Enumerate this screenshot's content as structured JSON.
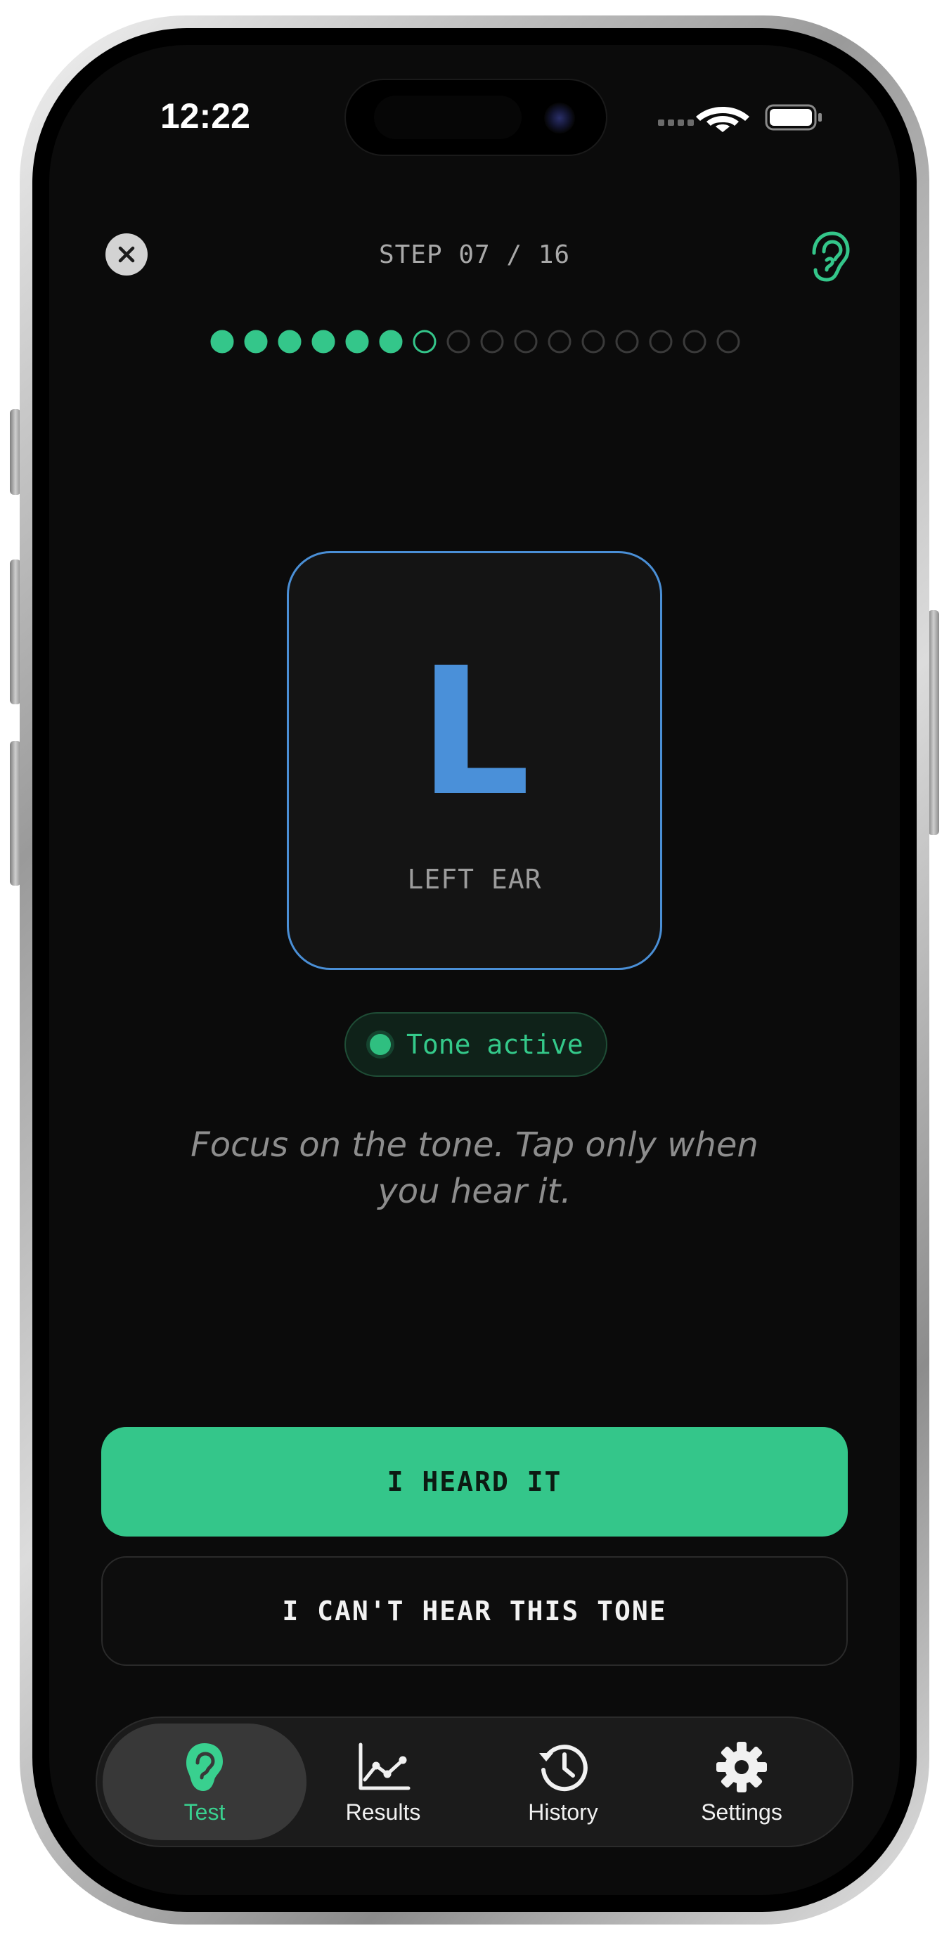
{
  "status_bar": {
    "time": "12:22"
  },
  "header": {
    "step_label": "STEP 07 / 16",
    "progress": {
      "current": 7,
      "total": 16,
      "completed": 6
    }
  },
  "ear_card": {
    "letter": "L",
    "caption": "LEFT EAR"
  },
  "tone_status": {
    "label": "Tone active"
  },
  "instruction": "Focus on the tone. Tap only when you hear it.",
  "actions": {
    "heard_label": "I HEARD IT",
    "cant_hear_label": "I CAN'T HEAR THIS TONE"
  },
  "tabs": [
    {
      "label": "Test",
      "icon": "ear-icon",
      "active": true
    },
    {
      "label": "Results",
      "icon": "chart-icon",
      "active": false
    },
    {
      "label": "History",
      "icon": "history-icon",
      "active": false
    },
    {
      "label": "Settings",
      "icon": "gear-icon",
      "active": false
    }
  ],
  "colors": {
    "accent_green": "#34c68a",
    "accent_blue": "#4a90d9",
    "background": "#0b0b0b"
  }
}
